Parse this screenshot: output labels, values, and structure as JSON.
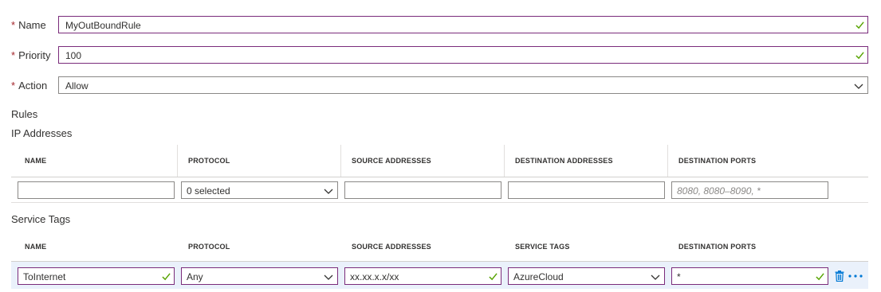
{
  "form": {
    "name": {
      "label": "Name",
      "required_mark": "*",
      "value": "MyOutBoundRule"
    },
    "priority": {
      "label": "Priority",
      "required_mark": "*",
      "value": "100"
    },
    "action": {
      "label": "Action",
      "required_mark": "*",
      "value": "Allow"
    }
  },
  "rules_heading": "Rules",
  "ip_addresses": {
    "heading": "IP Addresses",
    "columns": [
      "NAME",
      "PROTOCOL",
      "SOURCE ADDRESSES",
      "DESTINATION ADDRESSES",
      "DESTINATION PORTS"
    ],
    "row": {
      "name": "",
      "protocol": "0 selected",
      "source": "",
      "destination": "",
      "ports_placeholder": "8080, 8080–8090, *"
    }
  },
  "service_tags": {
    "heading": "Service Tags",
    "columns": [
      "NAME",
      "PROTOCOL",
      "SOURCE ADDRESSES",
      "SERVICE TAGS",
      "DESTINATION PORTS"
    ],
    "row": {
      "name": "ToInternet",
      "protocol": "Any",
      "source": "xx.xx.x.x/xx",
      "service_tag": "AzureCloud",
      "ports": "*"
    }
  },
  "colors": {
    "valid_border": "#7a2b7b",
    "check_green": "#57a300",
    "required_red": "#a4262c",
    "selected_row": "#eaf1fb",
    "accent_blue": "#0078d4"
  }
}
